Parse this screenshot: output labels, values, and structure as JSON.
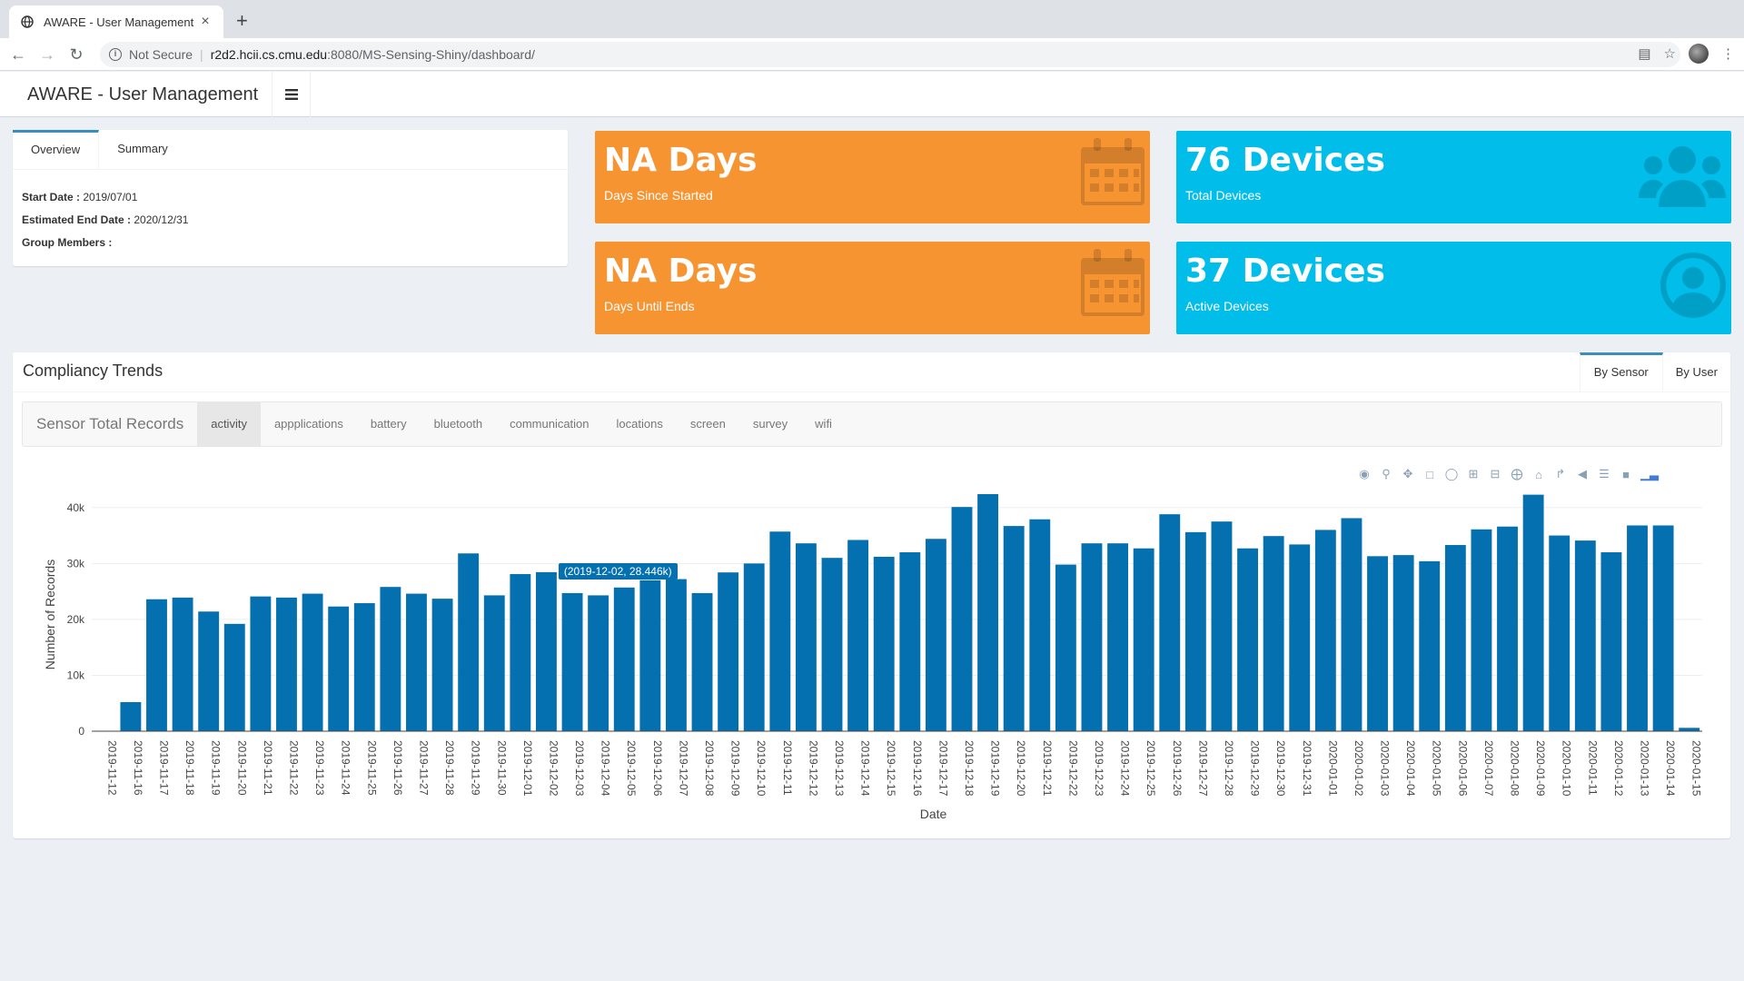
{
  "browser": {
    "tab_title": "AWARE - User Management",
    "close_glyph": "×",
    "new_tab_glyph": "+",
    "security": "Not Secure",
    "host": "r2d2.hcii.cs.cmu.edu",
    "path": ":8080/MS-Sensing-Shiny/dashboard/"
  },
  "app": {
    "brand": "AWARE - User Management"
  },
  "overview": {
    "tabs": [
      "Overview",
      "Summary"
    ],
    "start_label": "Start Date :",
    "start_value": " 2019/07/01",
    "end_label": "Estimated End Date :",
    "end_value": " 2020/12/31",
    "members_label": "Group Members :"
  },
  "valueboxes": {
    "days_started": {
      "value": "NA Days",
      "label": "Days Since Started",
      "icon": "calendar-icon"
    },
    "total_devices": {
      "value": "76 Devices",
      "label": "Total Devices",
      "icon": "users-icon"
    },
    "days_until": {
      "value": "NA Days",
      "label": "Days Until Ends",
      "icon": "calendar-icon"
    },
    "active_devices": {
      "value": "37 Devices",
      "label": "Active Devices",
      "icon": "user-circle-icon"
    }
  },
  "compliancy": {
    "title": "Compliancy Trends",
    "tabs": [
      "By Sensor",
      "By User"
    ],
    "sensor_label": "Sensor Total Records",
    "sensors": [
      "activity",
      "appplications",
      "battery",
      "bluetooth",
      "communication",
      "locations",
      "screen",
      "survey",
      "wifi"
    ],
    "active_sensor": "activity"
  },
  "colors": {
    "bar": "#0570b0",
    "orange": "#f79432",
    "blue": "#00bde9"
  },
  "chart_data": {
    "type": "bar",
    "xlabel": "Date",
    "ylabel": "Number of Records",
    "yticks": [
      "0",
      "10k",
      "20k",
      "30k",
      "40k"
    ],
    "ylim": [
      0,
      45000
    ],
    "grid": true,
    "tooltip": {
      "category": "2019-12-02",
      "text": "(2019-12-02, 28.446k)"
    },
    "categories": [
      "2019-11-12",
      "2019-11-16",
      "2019-11-17",
      "2019-11-18",
      "2019-11-19",
      "2019-11-20",
      "2019-11-21",
      "2019-11-22",
      "2019-11-23",
      "2019-11-24",
      "2019-11-25",
      "2019-11-26",
      "2019-11-27",
      "2019-11-28",
      "2019-11-29",
      "2019-11-30",
      "2019-12-01",
      "2019-12-02",
      "2019-12-03",
      "2019-12-04",
      "2019-12-05",
      "2019-12-06",
      "2019-12-07",
      "2019-12-08",
      "2019-12-09",
      "2019-12-10",
      "2019-12-11",
      "2019-12-12",
      "2019-12-13",
      "2019-12-14",
      "2019-12-15",
      "2019-12-16",
      "2019-12-17",
      "2019-12-18",
      "2019-12-19",
      "2019-12-20",
      "2019-12-21",
      "2019-12-22",
      "2019-12-23",
      "2019-12-24",
      "2019-12-25",
      "2019-12-26",
      "2019-12-27",
      "2019-12-28",
      "2019-12-29",
      "2019-12-30",
      "2019-12-31",
      "2020-01-01",
      "2020-01-02",
      "2020-01-03",
      "2020-01-04",
      "2020-01-05",
      "2020-01-06",
      "2020-01-07",
      "2020-01-08",
      "2020-01-09",
      "2020-01-10",
      "2020-01-11",
      "2020-01-12",
      "2020-01-13",
      "2020-01-14",
      "2020-01-15"
    ],
    "values": [
      0,
      5200,
      23600,
      23900,
      21400,
      19200,
      24100,
      23900,
      24600,
      22300,
      22900,
      25800,
      24600,
      23700,
      31800,
      24300,
      28100,
      28446,
      24700,
      24300,
      25700,
      27000,
      27200,
      24700,
      28400,
      30000,
      35700,
      33600,
      31000,
      34200,
      31200,
      32000,
      34400,
      40100,
      42400,
      36700,
      37900,
      29800,
      33600,
      33600,
      32700,
      38800,
      35600,
      37500,
      32700,
      34900,
      33400,
      36000,
      38100,
      31300,
      31500,
      30400,
      33300,
      36100,
      36600,
      42300,
      35000,
      34100,
      32000,
      36800,
      36800,
      600
    ]
  }
}
